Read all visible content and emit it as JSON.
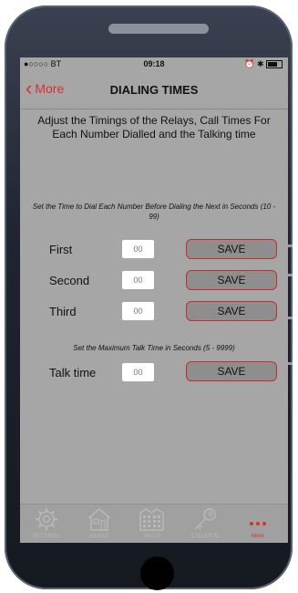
{
  "status": {
    "carrier": "●○○○○ BT",
    "time": "09:18",
    "icons": "⏰ ✱"
  },
  "nav": {
    "back_label": "More",
    "title": "DIALING TIMES"
  },
  "intro": "Adjust the Timings of the Relays, Call Times For Each Number Dialled and the Talking time",
  "dial_hint": "Set the Time to Dial Each Number Before Dialing the Next in Seconds (10 - 99)",
  "talk_hint": "Set the Maximum Talk Time in Seconds (5 - 9999)",
  "rows": [
    {
      "label": "First",
      "placeholder": "00",
      "button": "SAVE"
    },
    {
      "label": "Second",
      "placeholder": "00",
      "button": "SAVE"
    },
    {
      "label": "Third",
      "placeholder": "00",
      "button": "SAVE"
    },
    {
      "label": "Talk time",
      "placeholder": "00",
      "button": "SAVE"
    }
  ],
  "tabs": [
    {
      "label": "SETTINGS",
      "icon": "gear-icon"
    },
    {
      "label": "SINGLE",
      "icon": "house-icon"
    },
    {
      "label": "MULTI",
      "icon": "apartment-icon"
    },
    {
      "label": "CALLER ID",
      "icon": "key-icon"
    },
    {
      "label": "More",
      "icon": "more-dots-icon",
      "active": true
    }
  ],
  "colors": {
    "accent": "#d9302c",
    "screen_bg": "#a6a6a6",
    "button_bg": "#8e8e8e"
  }
}
